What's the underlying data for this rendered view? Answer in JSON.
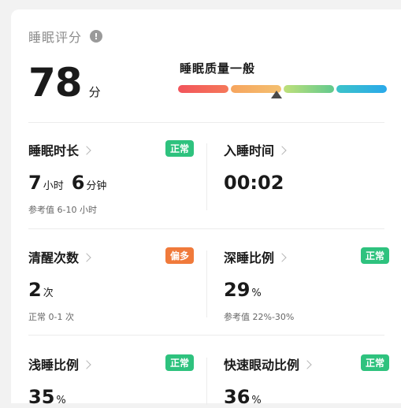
{
  "header": {
    "title": "睡眠评分",
    "info_icon": "!"
  },
  "score": {
    "value": "78",
    "unit": "分",
    "quality_label": "睡眠质量一般"
  },
  "quality_bar": {
    "segments": [
      "#f2545b",
      "#f6b26b",
      "#7fd08a",
      "#2ab7e8"
    ],
    "marker_color": "#4a4a4a"
  },
  "metrics": {
    "duration": {
      "title": "睡眠时长",
      "badge": "正常",
      "hours": "7",
      "hours_unit": "小时",
      "minutes": "6",
      "minutes_unit": "分钟",
      "ref": "参考值 6-10 小时"
    },
    "fall_asleep": {
      "title": "入睡时间",
      "value": "00:02"
    },
    "wake_count": {
      "title": "清醒次数",
      "badge": "偏多",
      "value": "2",
      "unit": "次",
      "ref": "正常 0-1 次"
    },
    "deep_ratio": {
      "title": "深睡比例",
      "badge": "正常",
      "value": "29",
      "unit": "%",
      "ref": "参考值 22%-30%"
    },
    "light_ratio": {
      "title": "浅睡比例",
      "badge": "正常",
      "value": "35",
      "unit": "%"
    },
    "rem_ratio": {
      "title": "快速眼动比例",
      "badge": "正常",
      "value": "36",
      "unit": "%"
    }
  },
  "colors": {
    "badge_normal": "#2ec27e",
    "badge_warn": "#f07a3b"
  }
}
